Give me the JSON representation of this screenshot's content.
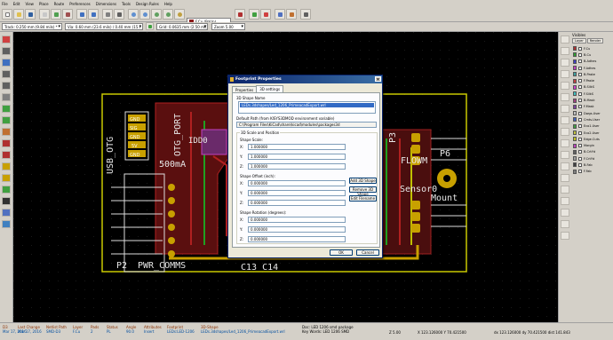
{
  "menu": [
    "File",
    "Edit",
    "View",
    "Place",
    "Route",
    "Preferences",
    "Dimensions",
    "Tools",
    "Design Rules",
    "Help"
  ],
  "toolbar": {
    "layer_select": "F.Cu (PgUp)",
    "track": "Track: 0.250 mm (9.84 mils) *",
    "via": "Via: 0.60 mm (23.6 mils) / 0.40 mm (15.7 mils) *",
    "grid": "Grid: 0.0635 mm (2.50 mil)",
    "zoom": "Zoom 5.00"
  },
  "dialog": {
    "title": "Footprint Properties",
    "tabs": [
      "Properties",
      "3D settings"
    ],
    "shape_name_label": "3D Shape Name",
    "shape_name": "LEDs.3dshapes/Led_1206_PrimeacadExport.wrl",
    "default_path_label": "Default Path (from KISYS3DMOD environment variable)",
    "default_path": "C:\\Program Files\\KiCad\\share\\kicad\\modules\\packages3d",
    "group_title": "3D Scale and Position",
    "scale_label": "Shape Scale:",
    "scale": [
      "1.000000",
      "1.000000",
      "1.000000"
    ],
    "offset_label": "Shape Offset (inch):",
    "offset": [
      "0.000000",
      "0.000000",
      "0.000000"
    ],
    "rotation_label": "Shape Rotation (degrees):",
    "rotation": [
      "0.000000",
      "0.000000",
      "0.000000"
    ],
    "axes": [
      "X:",
      "Y:",
      "Z:"
    ],
    "add_button": "Add 3D Shape",
    "remove_button": "Remove 3D Shape",
    "edit_button": "Edit Filename",
    "ok_button": "OK",
    "cancel_button": "Cancel"
  },
  "visibles": {
    "title": "Visibles",
    "tabs": [
      "Layer",
      "Render"
    ],
    "layers": [
      {
        "name": "F.Cu",
        "color": "#b03030"
      },
      {
        "name": "B.Cu",
        "color": "#30a030"
      },
      {
        "name": "B.Adhes",
        "color": "#4040c0"
      },
      {
        "name": "F.Adhes",
        "color": "#c040c0"
      },
      {
        "name": "B.Paste",
        "color": "#40a0a0"
      },
      {
        "name": "F.Paste",
        "color": "#c04040"
      },
      {
        "name": "B.SilkS",
        "color": "#d040d0"
      },
      {
        "name": "F.SilkS",
        "color": "#40c0c0"
      },
      {
        "name": "B.Mask",
        "color": "#a04080"
      },
      {
        "name": "F.Mask",
        "color": "#8040a0"
      },
      {
        "name": "Dwgs.User",
        "color": "#c0c0c0"
      },
      {
        "name": "Cmts.User",
        "color": "#4060c0"
      },
      {
        "name": "Eco1.User",
        "color": "#40a040"
      },
      {
        "name": "Eco2.User",
        "color": "#c0c040"
      },
      {
        "name": "Edge.Cuts",
        "color": "#c0c020"
      },
      {
        "name": "Margin",
        "color": "#c040c0"
      },
      {
        "name": "B.CrtYd",
        "color": "#606060"
      },
      {
        "name": "F.CrtYd",
        "color": "#a0a0a0"
      },
      {
        "name": "B.Fab",
        "color": "#404040"
      },
      {
        "name": "F.Fab",
        "color": "#808080"
      }
    ]
  },
  "pcb": {
    "labels": {
      "usb_otg": "USB_OTG",
      "otg_port": "OTG_PORT",
      "idd0": "IDD0",
      "ma": "500mA",
      "p3": "P3",
      "flowm": "FLOWM",
      "p6": "P6",
      "mount": "Mount",
      "sensor0": "Sensor0",
      "p2": "P2",
      "pwr_comms": "PWR_COMMS",
      "c13": "C13 C14"
    },
    "pins": [
      "GND",
      "SIG",
      "GND",
      "5V",
      "GND",
      "GND"
    ]
  },
  "status": {
    "ref": {
      "k": "D3",
      "v": "Mar 17, 2016"
    },
    "last_change": {
      "k": "Last Change",
      "v": "Mar 17, 2016"
    },
    "netlist_path": {
      "k": "Netlist Path",
      "v": "SMD-D3"
    },
    "layer": {
      "k": "Layer",
      "v": "F.Cu"
    },
    "pads": {
      "k": "Pads",
      "v": "2"
    },
    "status": {
      "k": "Status",
      "v": "PL"
    },
    "angle": {
      "k": "Angle",
      "v": "90.0"
    },
    "attributes": {
      "k": "Attributes",
      "v": "Insert"
    },
    "footprint": {
      "k": "Footprint",
      "v": "LEDs:LED-1206"
    },
    "shape3d": {
      "k": "3D-Shape",
      "v": "LEDs.3dshapes/Led_1206_PrimeacadExport.wrl"
    },
    "doc": "Doc: LED 1206 smd package",
    "keywords": "Key Words: LED 1206 SMD",
    "zoom": "Z 5.00",
    "xy": "X 123.126000  Y 70.421500",
    "dxy": "dx 123.126000  dy 70.421500  dist 141.843"
  }
}
